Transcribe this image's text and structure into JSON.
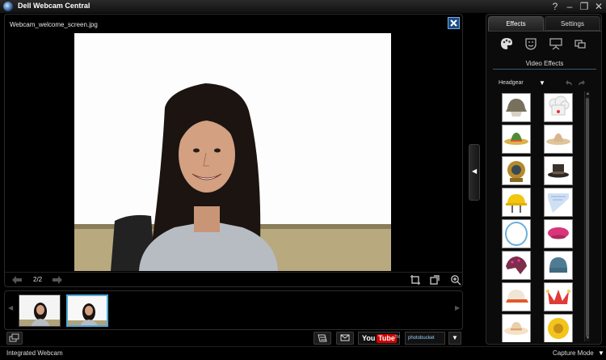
{
  "window": {
    "title": "Dell Webcam Central",
    "help_glyph": "?",
    "minimize_glyph": "–",
    "restore_glyph": "❐",
    "close_glyph": "✕"
  },
  "viewer": {
    "filename": "Webcam_welcome_screen.jpg",
    "page_counter": "2/2"
  },
  "collapse_tab": {
    "glyph": "◀"
  },
  "filmstrip": {
    "left_arrow": "◀",
    "right_arrow": "▶",
    "thumbnails": [
      {
        "name": "thumbnail-1",
        "selected": false
      },
      {
        "name": "thumbnail-2",
        "selected": true
      }
    ]
  },
  "bottombar": {
    "youtube_you": "You",
    "youtube_tube": "Tube",
    "youtube_tm": "TM",
    "photobucket": "photobucket",
    "dropdown_glyph": "▼"
  },
  "status": {
    "device": "Integrated Webcam",
    "capture_mode": "Capture Mode",
    "capture_caret": "▼"
  },
  "effects_panel": {
    "tabs": [
      "Effects",
      "Settings"
    ],
    "active_tab": "Effects",
    "section_title": "Video Effects",
    "category": "Headgear",
    "category_caret": "▼",
    "scroll_up": "▲",
    "scroll_down": "▼",
    "items": [
      "army-helmet",
      "chef-hat",
      "sombrero-green",
      "sombrero-tan",
      "diving-helmet",
      "top-hat",
      "hard-hat",
      "bandana-blue",
      "halo-ring",
      "beret-pink",
      "bandana-red",
      "beanie-blue",
      "baseball-cap-red",
      "jester-hat-red",
      "sun-hat",
      "sunflower-hat"
    ]
  },
  "colors": {
    "accent": "#4ea9d8",
    "close_box": "#1a4d86",
    "youtube_red": "#d10000"
  }
}
